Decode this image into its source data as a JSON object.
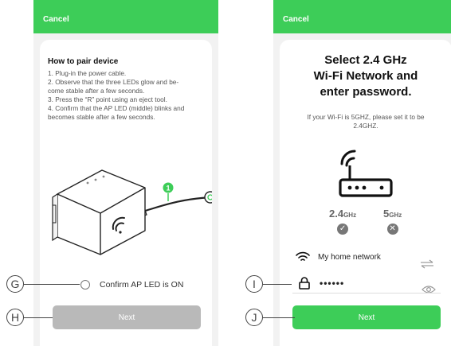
{
  "left_screen": {
    "cancel_label": "Cancel",
    "howto_title": "How to pair device",
    "steps": [
      "1. Plug-in the power cable.",
      "2. Observe that the three LEDs glow and be-",
      "come stable after a few seconds.",
      "3. Press the “R” point using an eject tool.",
      "4. Confirm that the AP LED (middle) blinks and",
      "becomes stable after a few seconds."
    ],
    "badge_number": "1",
    "confirm_label": "Confirm AP LED is ON",
    "next_label": "Next"
  },
  "right_screen": {
    "cancel_label": "Cancel",
    "title_line1": "Select 2.4 GHz",
    "title_line2": "Wi-Fi Network and",
    "title_line3": "enter password.",
    "note": "If your Wi-Fi is 5GHZ, please set it to be 2.4GHZ.",
    "band_24_num": "2.4",
    "band_24_unit": "GHz",
    "band_5_num": "5",
    "band_5_unit": "GHz",
    "band_24_mark": "✓",
    "band_5_mark": "✕",
    "network_name": "My home network",
    "password_masked": "••••••",
    "next_label": "Next"
  },
  "callouts": {
    "g": "G",
    "h": "H",
    "i": "I",
    "j": "J"
  },
  "colors": {
    "accent": "#3dcd58",
    "disabled": "#b9b9b9",
    "background": "#f2f2f2"
  }
}
